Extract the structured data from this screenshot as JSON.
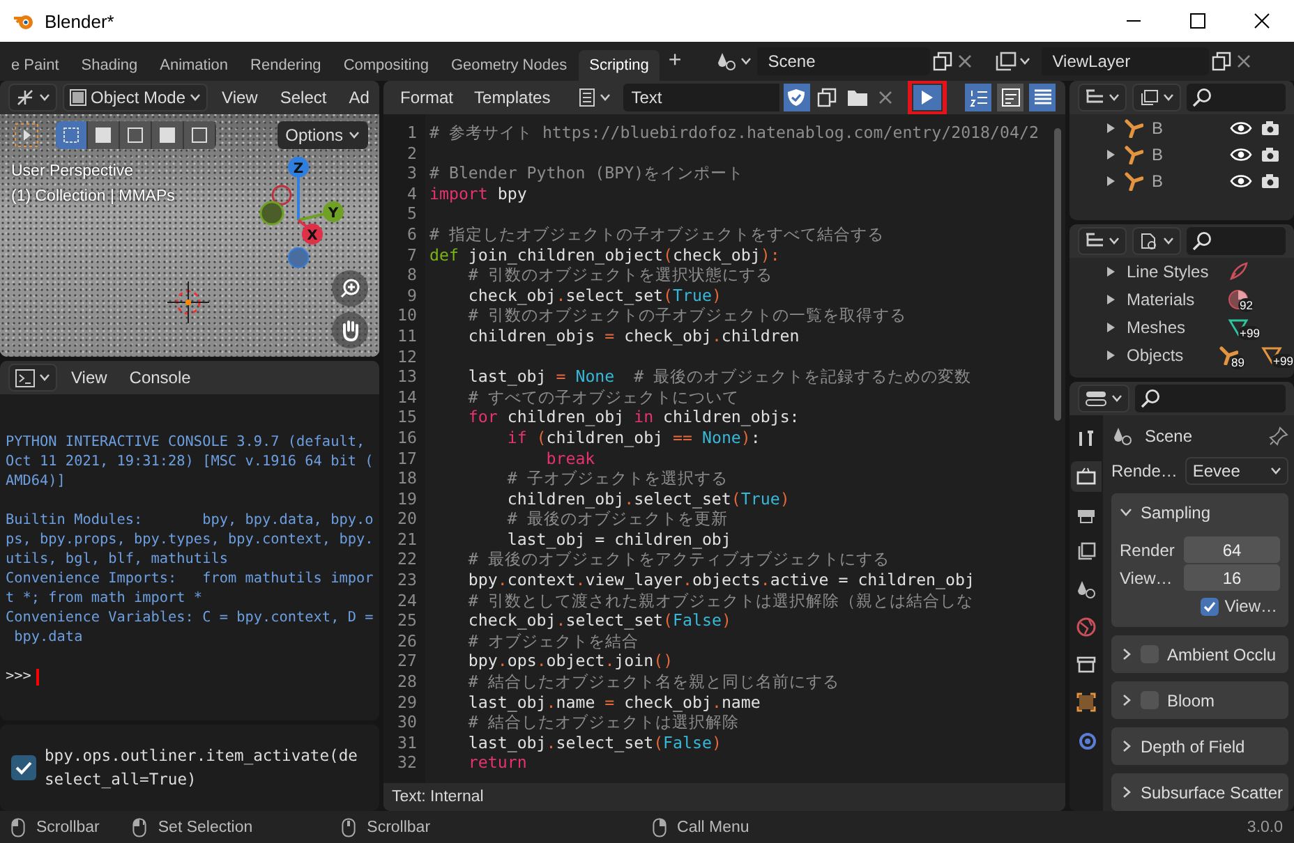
{
  "window": {
    "title": "Blender*"
  },
  "workspace_tabs": [
    {
      "label": "e Paint",
      "selected": false
    },
    {
      "label": "Shading",
      "selected": false
    },
    {
      "label": "Animation",
      "selected": false
    },
    {
      "label": "Rendering",
      "selected": false
    },
    {
      "label": "Compositing",
      "selected": false
    },
    {
      "label": "Geometry Nodes",
      "selected": false
    },
    {
      "label": "Scripting",
      "selected": true
    }
  ],
  "add_tab": "+",
  "scene": {
    "value": "Scene"
  },
  "view_layer": {
    "value": "ViewLayer"
  },
  "viewport": {
    "mode": "Object Mode",
    "menus": [
      "View",
      "Select",
      "Ad"
    ],
    "select_modes": [
      {
        "selected": true
      },
      {
        "selected": false
      },
      {
        "selected": false
      },
      {
        "selected": false
      },
      {
        "selected": false
      }
    ],
    "options": "Options",
    "overlay_text": [
      "User Perspective",
      "(1) Collection | MMAPs"
    ],
    "gizmo_axes": [
      "Z",
      "Y",
      "X"
    ]
  },
  "console": {
    "menus": [
      "View",
      "Console"
    ],
    "messages": [
      {
        "lines": [
          "PYTHON INTERACTIVE CONSOLE 3.9.7 (default,",
          "Oct 11 2021, 19:31:28) [MSC v.1916 64 bit (",
          "AMD64)]"
        ]
      },
      {
        "lines": [
          "Builtin Modules:       bpy, bpy.data, bpy.o",
          "ps, bpy.props, bpy.types, bpy.context, bpy.",
          "utils, bgl, blf, mathutils",
          "Convenience Imports:   from mathutils impor",
          "t *; from math import *",
          "Convenience Variables: C = bpy.context, D =",
          " bpy.data"
        ]
      }
    ],
    "prompt": ">>>"
  },
  "info": {
    "entries": [
      {
        "lines": [
          "bpy.ops.outliner.item_activate(de",
          "select_all=True)"
        ]
      }
    ]
  },
  "text_editor": {
    "menus": [
      "Format",
      "Templates"
    ],
    "text_name": "Text",
    "view_toggles": [
      {
        "kind": "line-numbers",
        "selected": true
      },
      {
        "kind": "word-wrap",
        "selected": false
      },
      {
        "kind": "syntax",
        "selected": true
      }
    ],
    "lines": [
      {
        "number": "1",
        "tokens": [
          {
            "kind": "comment",
            "text": "# 参考サイト https://bluebirdofoz.hatenablog.com/entry/2018/04/2"
          }
        ]
      },
      {
        "number": "2"
      },
      {
        "number": "3",
        "tokens": [
          {
            "kind": "comment",
            "text": "# Blender Python (BPY)をインポート"
          }
        ]
      },
      {
        "number": "4",
        "tokens": [
          {
            "kind": "keyword",
            "text": "import"
          },
          {
            "kind": "plain",
            "text": " bpy"
          }
        ]
      },
      {
        "number": "5"
      },
      {
        "number": "6",
        "tokens": [
          {
            "kind": "comment",
            "text": "# 指定したオブジェクトの子オブジェクトをすべて結合する"
          }
        ]
      },
      {
        "number": "7",
        "tokens": [
          {
            "kind": "def",
            "text": "def"
          },
          {
            "kind": "plain",
            "text": " join_children_object"
          },
          {
            "kind": "op",
            "text": "("
          },
          {
            "kind": "plain",
            "text": "check_obj"
          },
          {
            "kind": "op",
            "text": "):"
          }
        ]
      },
      {
        "number": "8",
        "tokens": [
          {
            "kind": "comment",
            "text": "    # 引数のオブジェクトを選択状態にする"
          }
        ]
      },
      {
        "number": "9",
        "tokens": [
          {
            "kind": "plain",
            "text": "    check_obj"
          },
          {
            "kind": "op",
            "text": "."
          },
          {
            "kind": "plain",
            "text": "select_set"
          },
          {
            "kind": "op",
            "text": "("
          },
          {
            "kind": "const",
            "text": "True"
          },
          {
            "kind": "op",
            "text": ")"
          }
        ]
      },
      {
        "number": "10",
        "tokens": [
          {
            "kind": "comment",
            "text": "    # 引数のオブジェクトの子オブジェクトの一覧を取得する"
          }
        ]
      },
      {
        "number": "11",
        "tokens": [
          {
            "kind": "plain",
            "text": "    children_objs "
          },
          {
            "kind": "op",
            "text": "="
          },
          {
            "kind": "plain",
            "text": " check_obj"
          },
          {
            "kind": "op",
            "text": "."
          },
          {
            "kind": "plain",
            "text": "children"
          }
        ]
      },
      {
        "number": "12"
      },
      {
        "number": "13",
        "tokens": [
          {
            "kind": "plain",
            "text": "    last_obj "
          },
          {
            "kind": "op",
            "text": "="
          },
          {
            "kind": "const",
            "text": " None"
          },
          {
            "kind": "comment",
            "text": "  # 最後のオブジェクトを記録するための変数"
          }
        ]
      },
      {
        "number": "14",
        "tokens": [
          {
            "kind": "comment",
            "text": "    # すべての子オブジェクトについて"
          }
        ]
      },
      {
        "number": "15",
        "tokens": [
          {
            "kind": "keyword",
            "text": "    for"
          },
          {
            "kind": "plain",
            "text": " children_obj "
          },
          {
            "kind": "keyword",
            "text": "in"
          },
          {
            "kind": "plain",
            "text": " children_objs:"
          }
        ]
      },
      {
        "number": "16",
        "tokens": [
          {
            "kind": "keyword",
            "text": "        if"
          },
          {
            "kind": "op",
            "text": " ("
          },
          {
            "kind": "plain",
            "text": "children_obj "
          },
          {
            "kind": "op",
            "text": "=="
          },
          {
            "kind": "const",
            "text": " None"
          },
          {
            "kind": "op",
            "text": ")"
          },
          {
            "kind": "plain",
            "text": ":"
          }
        ]
      },
      {
        "number": "17",
        "tokens": [
          {
            "kind": "keyword",
            "text": "            break"
          }
        ]
      },
      {
        "number": "18",
        "tokens": [
          {
            "kind": "comment",
            "text": "        # 子オブジェクトを選択する"
          }
        ]
      },
      {
        "number": "19",
        "tokens": [
          {
            "kind": "plain",
            "text": "        children_obj"
          },
          {
            "kind": "op",
            "text": "."
          },
          {
            "kind": "plain",
            "text": "select_set"
          },
          {
            "kind": "op",
            "text": "("
          },
          {
            "kind": "const",
            "text": "True"
          },
          {
            "kind": "op",
            "text": ")"
          }
        ]
      },
      {
        "number": "20",
        "tokens": [
          {
            "kind": "comment",
            "text": "        # 最後のオブジェクトを更新"
          }
        ]
      },
      {
        "number": "21",
        "tokens": [
          {
            "kind": "plain",
            "text": "        last_obj = children_obj"
          }
        ]
      },
      {
        "number": "22",
        "tokens": [
          {
            "kind": "comment",
            "text": "    # 最後のオブジェクトをアクティブオブジェクトにする"
          }
        ]
      },
      {
        "number": "23",
        "tokens": [
          {
            "kind": "plain",
            "text": "    bpy"
          },
          {
            "kind": "op",
            "text": "."
          },
          {
            "kind": "plain",
            "text": "context"
          },
          {
            "kind": "op",
            "text": "."
          },
          {
            "kind": "plain",
            "text": "view_layer"
          },
          {
            "kind": "op",
            "text": "."
          },
          {
            "kind": "plain",
            "text": "objects"
          },
          {
            "kind": "op",
            "text": "."
          },
          {
            "kind": "plain",
            "text": "active = children_obj"
          }
        ]
      },
      {
        "number": "24",
        "tokens": [
          {
            "kind": "comment",
            "text": "    # 引数として渡された親オブジェクトは選択解除（親とは結合しな"
          }
        ]
      },
      {
        "number": "25",
        "tokens": [
          {
            "kind": "plain",
            "text": "    check_obj"
          },
          {
            "kind": "op",
            "text": "."
          },
          {
            "kind": "plain",
            "text": "select_set"
          },
          {
            "kind": "op",
            "text": "("
          },
          {
            "kind": "const",
            "text": "False"
          },
          {
            "kind": "op",
            "text": ")"
          }
        ]
      },
      {
        "number": "26",
        "tokens": [
          {
            "kind": "comment",
            "text": "    # オブジェクトを結合"
          }
        ]
      },
      {
        "number": "27",
        "tokens": [
          {
            "kind": "plain",
            "text": "    bpy"
          },
          {
            "kind": "op",
            "text": "."
          },
          {
            "kind": "plain",
            "text": "ops"
          },
          {
            "kind": "op",
            "text": "."
          },
          {
            "kind": "plain",
            "text": "object"
          },
          {
            "kind": "op",
            "text": "."
          },
          {
            "kind": "plain",
            "text": "join"
          },
          {
            "kind": "op",
            "text": "()"
          }
        ]
      },
      {
        "number": "28",
        "tokens": [
          {
            "kind": "comment",
            "text": "    # 結合したオブジェクト名を親と同じ名前にする"
          }
        ]
      },
      {
        "number": "29",
        "tokens": [
          {
            "kind": "plain",
            "text": "    last_obj"
          },
          {
            "kind": "op",
            "text": "."
          },
          {
            "kind": "plain",
            "text": "name "
          },
          {
            "kind": "op",
            "text": "="
          },
          {
            "kind": "plain",
            "text": " check_obj"
          },
          {
            "kind": "op",
            "text": "."
          },
          {
            "kind": "plain",
            "text": "name"
          }
        ]
      },
      {
        "number": "30",
        "tokens": [
          {
            "kind": "comment",
            "text": "    # 結合したオブジェクトは選択解除"
          }
        ]
      },
      {
        "number": "31",
        "tokens": [
          {
            "kind": "plain",
            "text": "    last_obj"
          },
          {
            "kind": "op",
            "text": "."
          },
          {
            "kind": "plain",
            "text": "select_set"
          },
          {
            "kind": "op",
            "text": "("
          },
          {
            "kind": "const",
            "text": "False"
          },
          {
            "kind": "op",
            "text": ")"
          }
        ]
      },
      {
        "number": "32",
        "tokens": [
          {
            "kind": "keyword",
            "text": "    return"
          }
        ]
      }
    ],
    "footer": "Text: Internal"
  },
  "outliner": {
    "rows": [
      {
        "label": "B"
      },
      {
        "label": "B"
      },
      {
        "label": "B"
      }
    ]
  },
  "blend_file": {
    "rows": [
      {
        "kind": "line-styles",
        "label": "Line Styles"
      },
      {
        "kind": "materials",
        "label": "Materials",
        "badges": [
          "92"
        ]
      },
      {
        "kind": "meshes",
        "label": "Meshes",
        "badges": [
          "+99"
        ]
      },
      {
        "kind": "objects",
        "label": "Objects",
        "badges": [
          "89",
          "+99"
        ]
      }
    ]
  },
  "properties": {
    "tabs": [
      {
        "kind": "tool",
        "selected": false
      },
      {
        "kind": "render",
        "selected": true
      },
      {
        "kind": "output",
        "selected": false
      },
      {
        "kind": "view-layer",
        "selected": false
      },
      {
        "kind": "scene",
        "selected": false
      },
      {
        "kind": "world",
        "selected": false
      },
      {
        "kind": "collection",
        "selected": false
      },
      {
        "kind": "object",
        "selected": false
      },
      {
        "kind": "physics",
        "selected": false
      }
    ],
    "context": "Scene",
    "render_label": "Rende…",
    "render_engine": "Eevee",
    "panels": [
      {
        "kind": "plain",
        "title": "Sampling",
        "expanded": true,
        "fields": [
          {
            "label": "Render",
            "value": "64"
          },
          {
            "label": "View…",
            "value": "16"
          }
        ],
        "checkbox": {
          "label": "View…",
          "checked": true
        }
      },
      {
        "kind": "toggle",
        "title": "Ambient Occlu",
        "expanded": false,
        "checked": false
      },
      {
        "kind": "toggle",
        "title": "Bloom",
        "expanded": false,
        "checked": false
      },
      {
        "kind": "plain",
        "title": "Depth of Field",
        "expanded": false
      },
      {
        "kind": "plain",
        "title": "Subsurface Scatter",
        "expanded": false
      }
    ]
  },
  "status_bar": {
    "hints": [
      {
        "kind": "mouse-left",
        "label": "Scrollbar"
      },
      {
        "kind": "mouse-drag",
        "label": "Set Selection"
      },
      {
        "kind": "mouse-middle",
        "label": "Scrollbar"
      },
      {
        "kind": "mouse-right",
        "label": "Call Menu"
      }
    ],
    "version": "3.0.0"
  }
}
